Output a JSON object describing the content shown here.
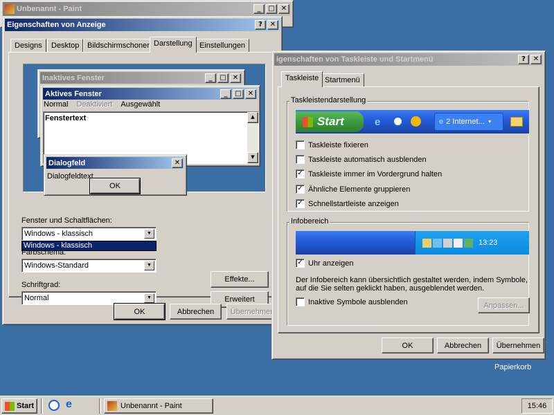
{
  "paint_window": {
    "title": "Unbenannt - Paint"
  },
  "display_props": {
    "title": "Eigenschaften von Anzeige",
    "tabs": [
      "Designs",
      "Desktop",
      "Bildschirmschoner",
      "Darstellung",
      "Einstellungen"
    ],
    "preview": {
      "inactive_title": "Inaktives Fenster",
      "active_title": "Aktives Fenster",
      "menu": [
        "Normal",
        "Deaktiviert",
        "Ausgewählt"
      ],
      "window_text": "Fenstertext",
      "dialog_title": "Dialogfeld",
      "dialog_text": "Dialogfeldtext",
      "dialog_ok": "OK"
    },
    "fields": {
      "windows_buttons_label": "Fenster und Schaltflächen:",
      "windows_buttons_value": "Windows - klassisch",
      "dropdown_option": "Windows - klassisch",
      "color_scheme_label": "Farbschema:",
      "color_scheme_value": "Windows-Standard",
      "font_size_label": "Schriftgrad:",
      "font_size_value": "Normal"
    },
    "effects_button": "Effekte...",
    "advanced_button": "Erweitert",
    "ok": "OK",
    "cancel": "Abbrechen",
    "apply": "Übernehmen"
  },
  "taskbar_props": {
    "title": "igenschaften von Taskleiste und Startmenü",
    "tabs": [
      "Taskleiste",
      "Startmenü"
    ],
    "group1_title": "Taskleistendarstellung",
    "preview_start": "Start",
    "preview_ie": "2 Internet...",
    "options": [
      {
        "label": "Taskleiste fixieren",
        "checked": false
      },
      {
        "label": "Taskleiste automatisch ausblenden",
        "checked": false
      },
      {
        "label": "Taskleiste immer im Vordergrund halten",
        "checked": true
      },
      {
        "label": "Ähnliche Elemente gruppieren",
        "checked": true
      },
      {
        "label": "Schnellstartleiste anzeigen",
        "checked": true
      }
    ],
    "group2_title": "Infobereich",
    "tray_clock": "13:23",
    "show_clock": {
      "label": "Uhr anzeigen",
      "checked": true
    },
    "info_text_1": "Der Infobereich kann übersichtlich gestaltet werden, indem Symbole,",
    "info_text_2": "auf die Sie selten geklickt haben, ausgeblendet werden.",
    "hide_inactive": {
      "label": "Inaktive Symbole ausblenden",
      "checked": false
    },
    "customize_button": "Anpassen...",
    "ok": "OK",
    "cancel": "Abbrechen",
    "apply": "Übernehmen"
  },
  "desktop": {
    "recycle_bin_label": "Papierkorb"
  },
  "taskbar": {
    "start_label": "Start",
    "task_paint": "Unbenannt - Paint",
    "clock": "15:46"
  },
  "colors": {
    "desktop": "#3a6ea5",
    "titlebar_active": "#0a246a",
    "xp_taskbar": "#245edb",
    "xp_start": "#3c9b3c"
  }
}
